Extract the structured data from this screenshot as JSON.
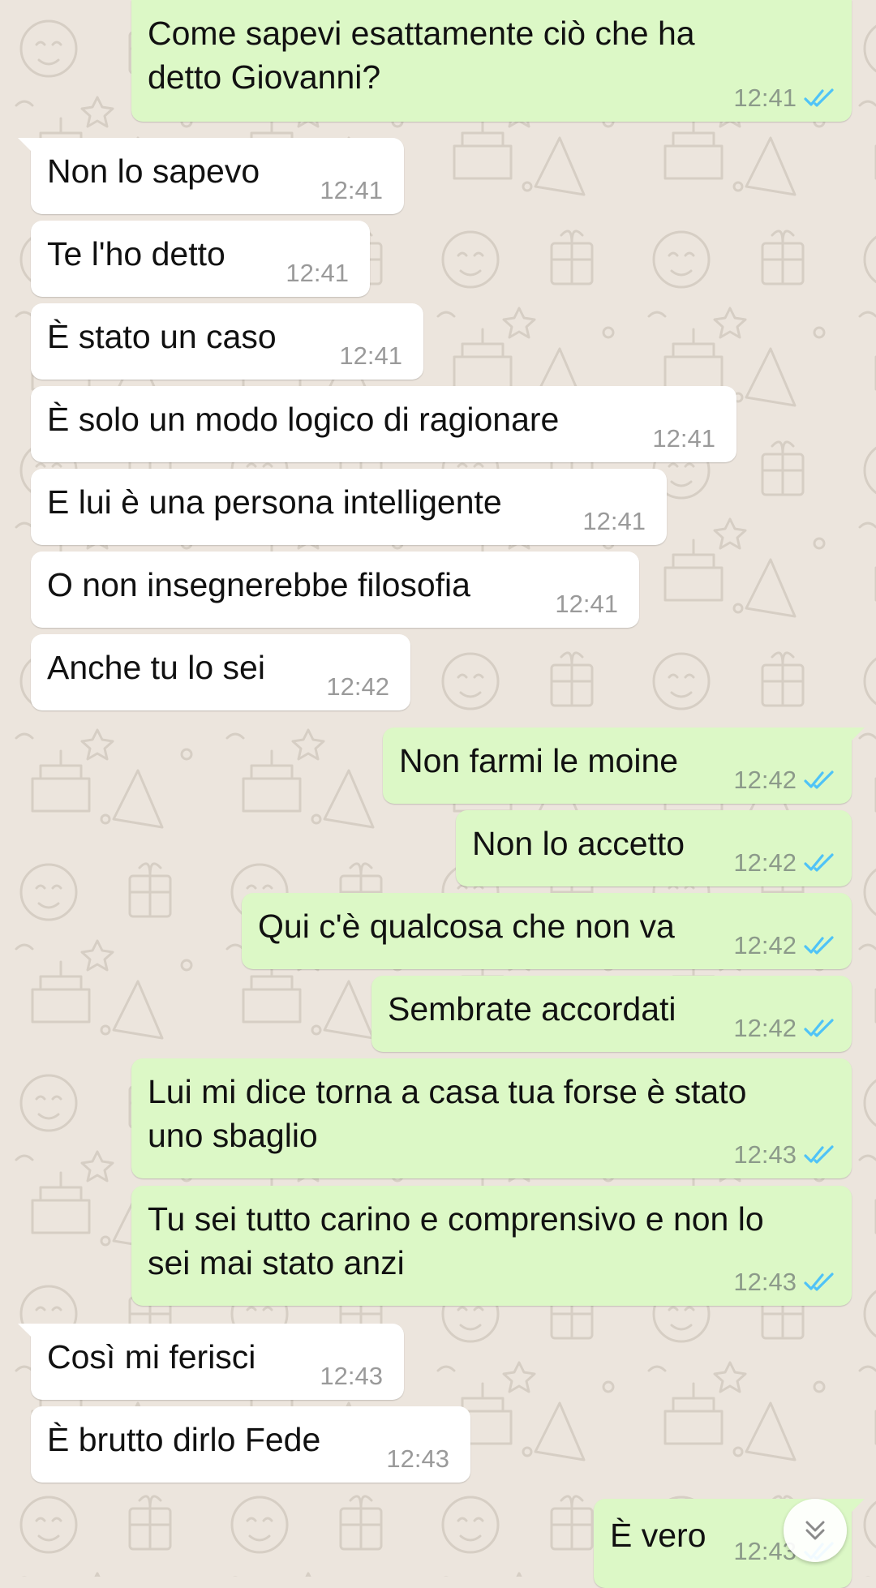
{
  "colors": {
    "background": "#ece5dd",
    "incoming_bubble": "#ffffff",
    "outgoing_bubble": "#dcf8c6",
    "read_ticks": "#4fc3f7"
  },
  "messages": [
    {
      "dir": "out",
      "text": "Come sapevi esattamente ciò che ha\ndetto Giovanni?",
      "time": "12:41",
      "status": "read"
    },
    {
      "dir": "in",
      "text": "Non lo sapevo",
      "time": "12:41"
    },
    {
      "dir": "in",
      "text": "Te l'ho detto",
      "time": "12:41"
    },
    {
      "dir": "in",
      "text": "È stato un caso",
      "time": "12:41"
    },
    {
      "dir": "in",
      "text": "È solo un modo logico di ragionare",
      "time": "12:41"
    },
    {
      "dir": "in",
      "text": "E lui è una persona intelligente",
      "time": "12:41"
    },
    {
      "dir": "in",
      "text": "O non insegnerebbe filosofia",
      "time": "12:41"
    },
    {
      "dir": "in",
      "text": "Anche tu lo sei",
      "time": "12:42"
    },
    {
      "dir": "out",
      "text": "Non farmi le moine",
      "time": "12:42",
      "status": "read"
    },
    {
      "dir": "out",
      "text": "Non lo accetto",
      "time": "12:42",
      "status": "read"
    },
    {
      "dir": "out",
      "text": "Qui c'è qualcosa che non va",
      "time": "12:42",
      "status": "read"
    },
    {
      "dir": "out",
      "text": "Sembrate accordati",
      "time": "12:42",
      "status": "read"
    },
    {
      "dir": "out",
      "text": "Lui mi dice torna a casa tua forse è stato\nuno sbaglio",
      "time": "12:43",
      "status": "read"
    },
    {
      "dir": "out",
      "text": "Tu sei tutto carino e comprensivo e non lo\nsei mai stato anzi",
      "time": "12:43",
      "status": "read"
    },
    {
      "dir": "in",
      "text": "Così mi ferisci",
      "time": "12:43"
    },
    {
      "dir": "in",
      "text": "È brutto dirlo Fede",
      "time": "12:43"
    },
    {
      "dir": "out",
      "text": "È vero",
      "time": "12:43",
      "status": "read"
    }
  ],
  "scroll_button": {
    "icon": "double-chevron-down-icon"
  }
}
